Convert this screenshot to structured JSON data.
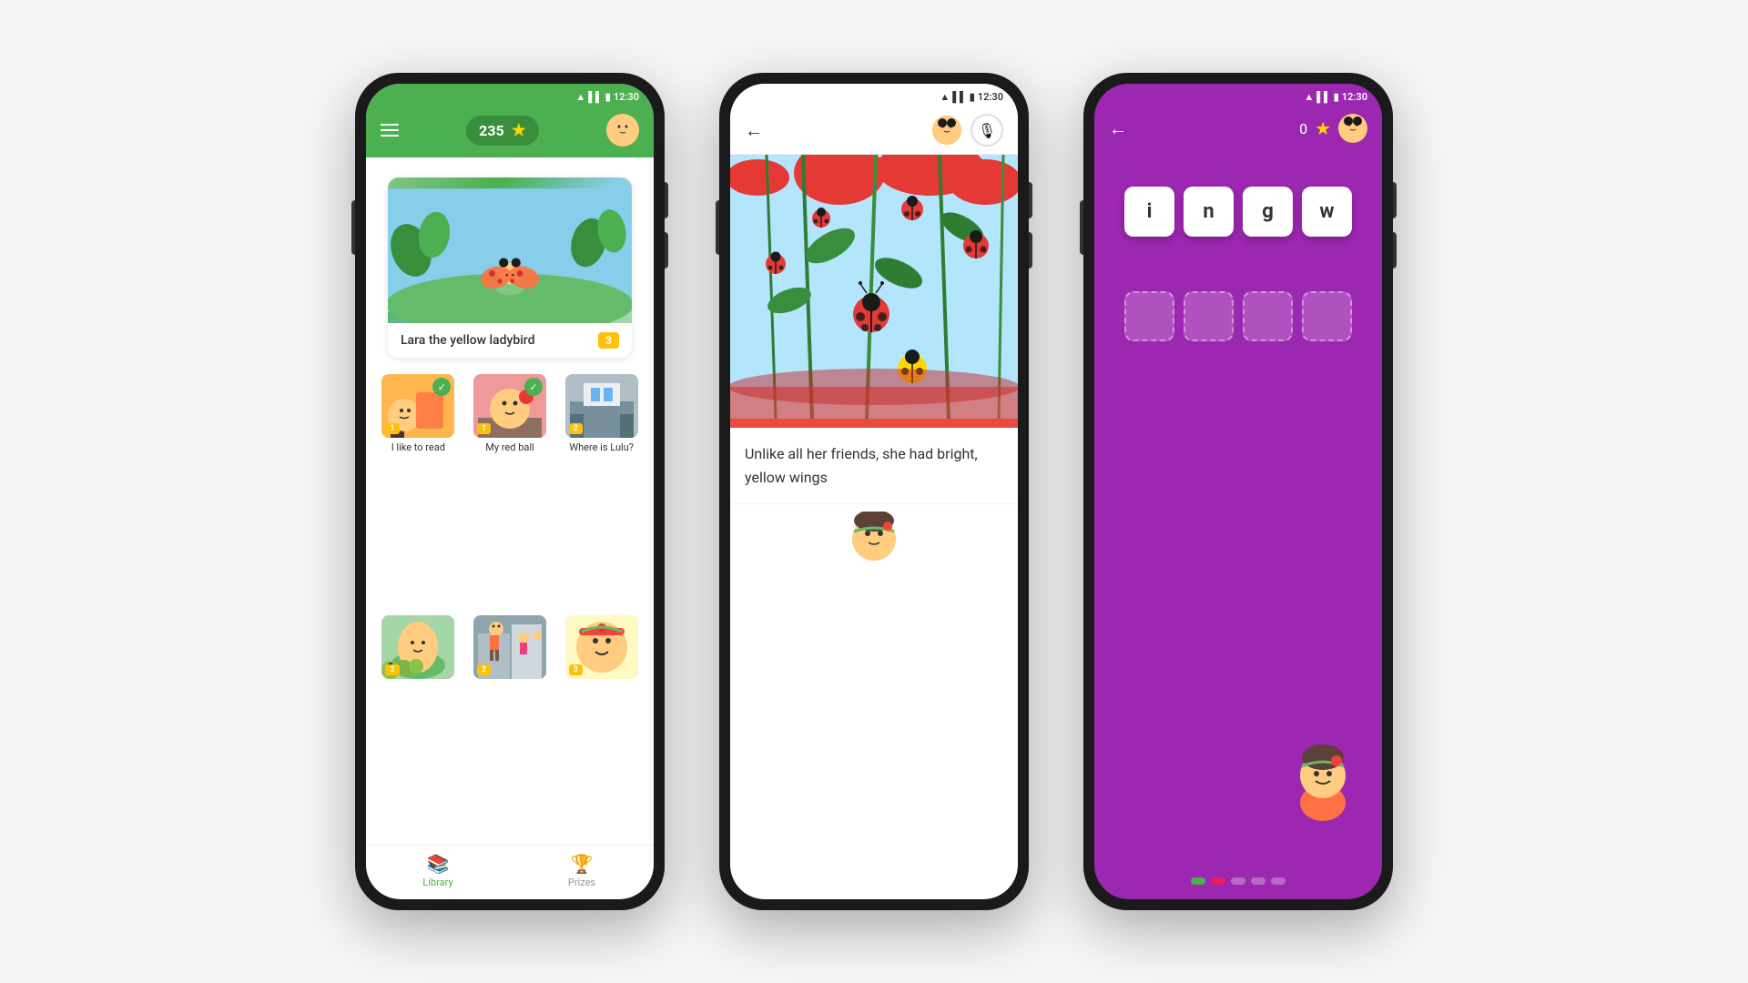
{
  "page": {
    "background": "#f5f5f5"
  },
  "phone1": {
    "status": {
      "time": "12:30",
      "icons": [
        "wifi",
        "signal",
        "battery"
      ]
    },
    "header": {
      "score": "235",
      "menu_label": "menu"
    },
    "featured_book": {
      "title": "Lara the yellow ladybird",
      "level": "3"
    },
    "books": [
      {
        "title": "I like to read",
        "level": "1",
        "completed": true
      },
      {
        "title": "My red ball",
        "level": "1",
        "completed": true
      },
      {
        "title": "Where is Lulu?",
        "level": "2",
        "completed": false
      },
      {
        "title": "",
        "level": "2",
        "completed": false
      },
      {
        "title": "",
        "level": "2",
        "completed": false
      },
      {
        "title": "",
        "level": "3",
        "completed": false
      }
    ],
    "nav": {
      "library_label": "Library",
      "prizes_label": "Prizes"
    }
  },
  "phone2": {
    "status": {
      "time": "12:30"
    },
    "story_text": "Unlike all her friends, she had bright, yellow wings",
    "back_label": "←"
  },
  "phone3": {
    "status": {
      "time": "12:30"
    },
    "score": "0",
    "back_label": "←",
    "letters": [
      "i",
      "n",
      "g",
      "w"
    ],
    "answer_slots": 4,
    "progress_colors": [
      "#4CAF50",
      "#E91E63",
      "#9C27B0",
      "#9C27B0",
      "#9C27B0"
    ]
  }
}
